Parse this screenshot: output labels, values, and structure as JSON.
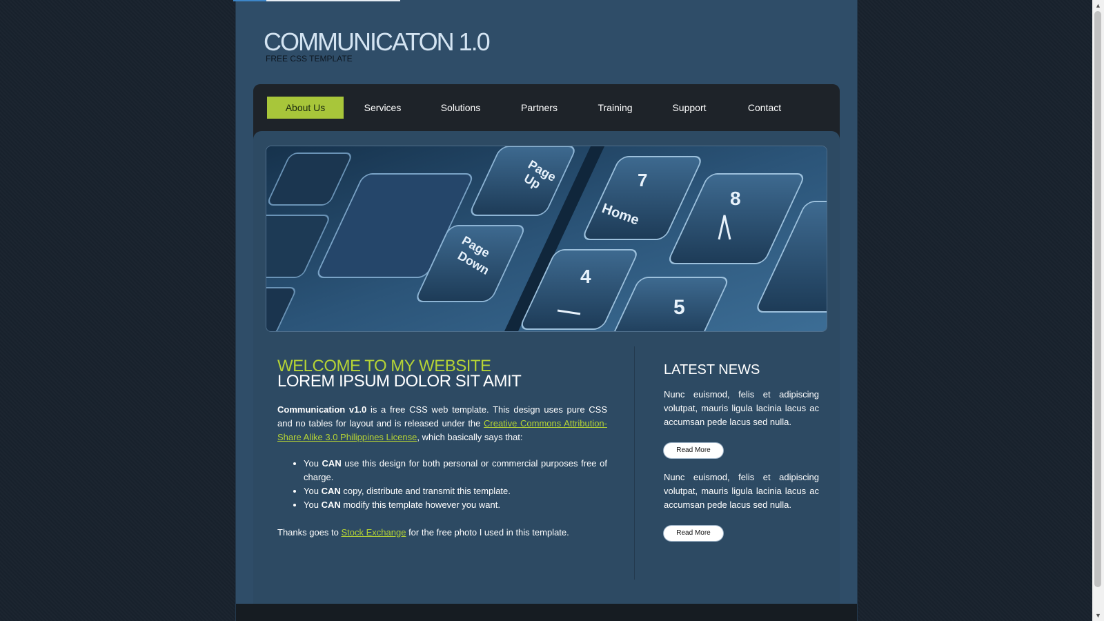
{
  "site": {
    "title": "COMMUNICATON 1.0",
    "subtitle": "FREE CSS TEMPLATE"
  },
  "nav": {
    "items": [
      {
        "label": "About Us",
        "active": true
      },
      {
        "label": "Services",
        "active": false
      },
      {
        "label": "Solutions",
        "active": false
      },
      {
        "label": "Partners",
        "active": false
      },
      {
        "label": "Training",
        "active": false
      },
      {
        "label": "Support",
        "active": false
      },
      {
        "label": "Contact",
        "active": false
      }
    ]
  },
  "hero": {
    "image": "keyboard-photo",
    "keys": [
      "Page Up",
      "Page Down",
      "Home",
      "7",
      "8",
      "4",
      "5"
    ]
  },
  "main": {
    "welcome_title": "WELCOME TO MY WEBSITE",
    "welcome_subtitle": "LOREM IPSUM DOLOR SIT AMIT",
    "intro_bold": "Communication v1.0",
    "intro_text_1": " is a free CSS web template. This design uses pure CSS and no tables for layout and is released under the ",
    "license_link": "Creative Commons Attribution-Share Alike 3.0 Philippines License",
    "intro_text_2": ", which basically says that:",
    "features": [
      {
        "pre": "You ",
        "bold": "CAN",
        "post": " use this design for both personal or commercial purposes free of charge."
      },
      {
        "pre": "You ",
        "bold": "CAN",
        "post": " copy, distribute and transmit this template."
      },
      {
        "pre": "You ",
        "bold": "CAN",
        "post": " modify this template however you want."
      }
    ],
    "thanks_pre": "Thanks goes to ",
    "thanks_link": "Stock Exchange",
    "thanks_post": " for the free photo I used in this template."
  },
  "sidebar": {
    "title": "LATEST NEWS",
    "news": [
      {
        "text": "Nunc euismod, felis et adipiscing volutpat, mauris ligula lacinia lacus ac accumsan pede lacus sed nulla.",
        "button": "Read More"
      },
      {
        "text": "Nunc euismod, felis et adipiscing volutpat, mauris ligula lacinia lacus ac accumsan pede lacus sed nulla.",
        "button": "Read More"
      }
    ]
  },
  "colors": {
    "accent": "#b5d335",
    "nav_active": "#a8c63a",
    "panel": "#2d4a63",
    "background": "#18222d"
  }
}
